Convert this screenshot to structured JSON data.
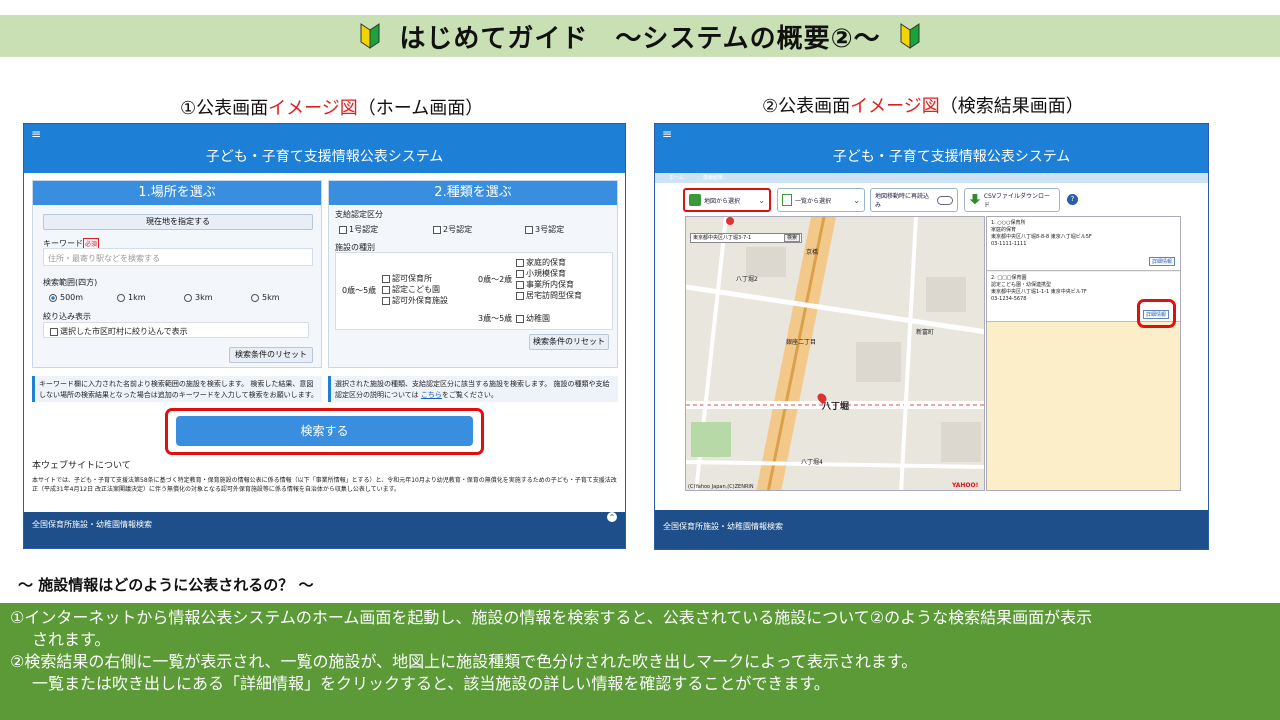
{
  "banner": {
    "title": "はじめてガイド　～システムの概要②～"
  },
  "caption1": {
    "prefix": "①公表画面",
    "red": "イメージ図",
    "suffix": "（ホーム画面）"
  },
  "caption2": {
    "prefix": "②公表画面",
    "red": "イメージ図",
    "suffix": "（検索結果画面）"
  },
  "home": {
    "menu_icon": "≡",
    "app_title": "子ども・子育て支援情報公表システム",
    "panel_location": {
      "title": "1.場所を選ぶ",
      "current_location_button": "現在地を指定する",
      "keyword_label": "キーワード",
      "keyword_badge": "必須",
      "keyword_placeholder": "住所・最寄り駅などを検索する",
      "range_label": "検索範囲(四方)",
      "range_options": [
        "500m",
        "1km",
        "3km",
        "5km"
      ],
      "range_selected": "500m",
      "filter_label": "絞り込み表示",
      "filter_checkbox": "選択した市区町村に絞り込んで表示",
      "reset_button": "検索条件のリセット"
    },
    "panel_type": {
      "title": "2.種類を選ぶ",
      "cert_label": "支給認定区分",
      "cert_options": [
        "1号認定",
        "2号認定",
        "3号認定"
      ],
      "facility_label": "施設の種別",
      "age_0_5": "0歳～5歳",
      "age_0_5_options": [
        "認可保育所",
        "認定こども園",
        "認可外保育施設"
      ],
      "age_0_2": "0歳～2歳",
      "age_0_2_options": [
        "家庭的保育",
        "小規模保育",
        "事業所内保育",
        "居宅訪問型保育"
      ],
      "age_3_5": "3歳～5歳",
      "age_3_5_options": [
        "幼稚園"
      ],
      "reset_button": "検索条件のリセット"
    },
    "info_left": "キーワード欄に入力された名前より検索範囲の施設を検索します。 検索した結果、意図しない場所の検索結果となった場合は追加のキーワードを入力して検索をお願いします。",
    "info_right_prefix": "選択された施設の種類、支給認定区分に該当する施設を検索します。 施設の種類や支給認定区分の説明については",
    "info_right_link": "こちら",
    "info_right_suffix": "をご覧ください。",
    "search_button": "検索する",
    "about_title": "本ウェブサイトについて",
    "about_text": "本サイトでは、子ども・子育て支援法第58条に基づく特定教育・保育施設の情報公表に係る情報（以下「事業所情報」とする）と、令和元年10月より幼児教育・保育の無償化を実施するための子ども・子育て支援法改正（平成31年4月12日 改正法案閣議決定）に伴う無償化の対象となる認可外保育施設等に係る情報を自治体から収集し公表しています。",
    "footer_text": "全国保育所施設・幼稚園情報検索",
    "scroll_top_icon": "⌃"
  },
  "results": {
    "menu_icon": "≡",
    "app_title": "子ども・子育て支援情報公表システム",
    "breadcrumb": [
      "ホーム",
      "検索結果"
    ],
    "tool_map_select": "地図から選択",
    "tool_list_select": "一覧から選択",
    "tool_resort": "地図移動時に再読込み",
    "tool_csv": "CSVファイルダウンロード",
    "help_icon": "?",
    "map_address": "東京都中央区八丁堀3-7-1",
    "map_search_button": "検索",
    "map_labels": [
      "八丁堀2",
      "八丁堀4",
      "八丁堀",
      "銀座二丁目",
      "京橋",
      "新富町"
    ],
    "map_copyright": "(C)Yahoo Japan,(C)ZENRIN",
    "map_logo": "YAHOO!",
    "cards": [
      {
        "name": "1. ○○○保育所",
        "type": "家庭的保育",
        "address": "東京都中央区八丁堀8-8-8 東京八丁堀ビル5F",
        "tel": "03-1111-1111",
        "detail": "詳細情報"
      },
      {
        "name": "2. □□□保育園",
        "type": "認定こども園・幼保連携型",
        "address": "東京都中央区八丁堀1-1-1 東京中央ビル7F",
        "tel": "03-1234-5678",
        "detail": "詳細情報"
      }
    ],
    "footer_text": "全国保育所施設・幼稚園情報検索"
  },
  "question": "～ 施設情報はどのように公表されるの？ ～",
  "explain": {
    "line1": "①インターネットから情報公表システムのホーム画面を起動し、施設の情報を検索すると、公表されている施設について②のような検索結果画面が表示",
    "line1b": "されます。",
    "line2": "②検索結果の右側に一覧が表示され、一覧の施設が、地図上に施設種類で色分けされた吹き出しマークによって表示されます。",
    "line3": "一覧または吹き出しにある「詳細情報」をクリックすると、該当施設の詳しい情報を確認することができます。"
  },
  "colors": {
    "banner": "#c8e0b4",
    "appbar": "#1e7fd6",
    "footer": "#1f4f8a",
    "explain": "#5b9a37",
    "highlight": "#e01010"
  }
}
